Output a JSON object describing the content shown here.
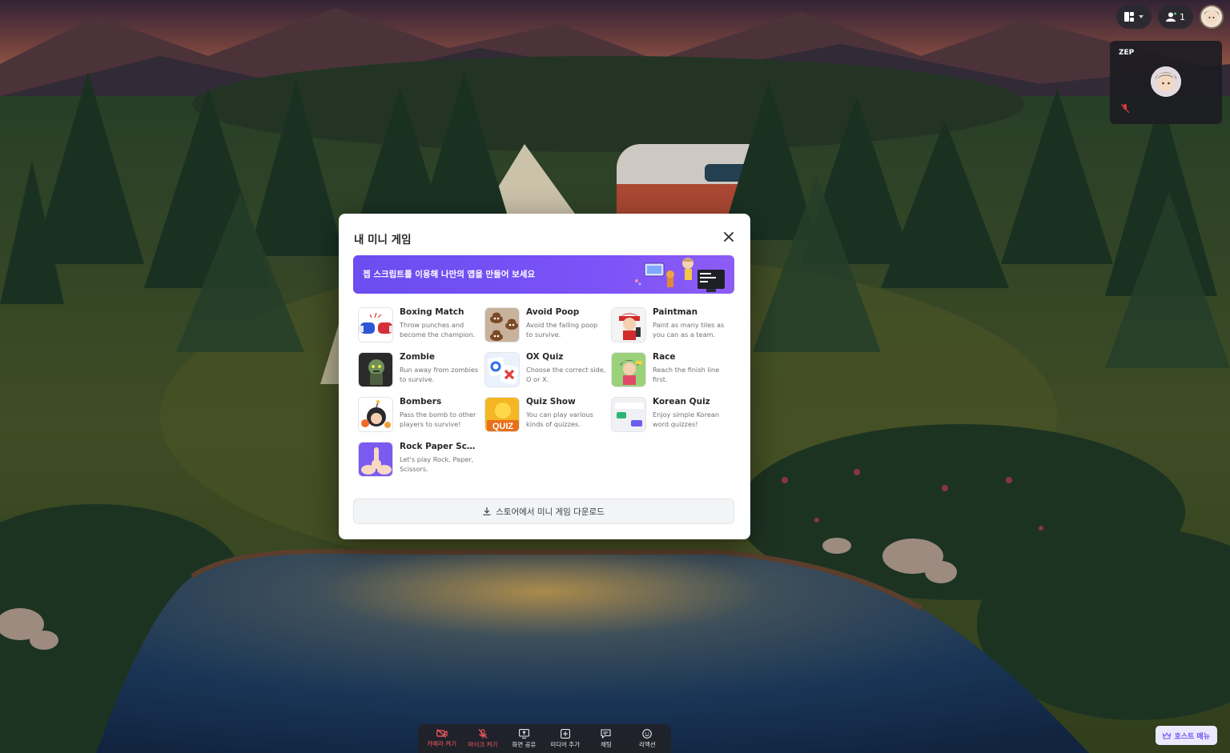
{
  "top_bar": {
    "layout_button_icon": "layout-grid-icon",
    "participants_count": "1",
    "participants_icon": "person-icon"
  },
  "video_tile": {
    "name": "ZEP",
    "mic_icon": "mic-off-icon"
  },
  "modal": {
    "title": "내 미니 게임",
    "close_icon": "close-icon",
    "banner_text": "젭 스크립트를 이용해 나만의 앱을 만들어 보세요",
    "games": [
      {
        "title": "Boxing Match",
        "desc": "Throw punches and become the champion.",
        "icon": "boxing-gloves-icon"
      },
      {
        "title": "Avoid Poop",
        "desc": "Avoid the falling poop to survive.",
        "icon": "poop-icon"
      },
      {
        "title": "Paintman",
        "desc": "Paint as many tiles as you can as a team.",
        "icon": "painter-character-icon"
      },
      {
        "title": "Zombie",
        "desc": "Run away from zombies to survive.",
        "icon": "zombie-icon"
      },
      {
        "title": "OX Quiz",
        "desc": "Choose the correct side, O or X.",
        "icon": "ox-quiz-icon"
      },
      {
        "title": "Race",
        "desc": "Reach the finish line first.",
        "icon": "racer-character-icon"
      },
      {
        "title": "Bombers",
        "desc": "Pass the bomb to other players to survive!",
        "icon": "bomber-character-icon"
      },
      {
        "title": "Quiz Show",
        "desc": "You can play various kinds of quizzes.",
        "icon": "quiz-show-icon"
      },
      {
        "title": "Korean Quiz",
        "desc": "Enjoy simple Korean word quizzes!",
        "icon": "korean-quiz-icon"
      },
      {
        "title": "Rock Paper Sciss...",
        "desc": "Let's play Rock, Paper, Scissors.",
        "icon": "hands-icon"
      }
    ],
    "download_label": "스토어에서 미니 게임 다운로드",
    "download_icon": "download-icon"
  },
  "bottom_bar": {
    "items": [
      {
        "label": "카메라 켜기",
        "icon": "camera-off-icon",
        "state": "off"
      },
      {
        "label": "마이크 켜기",
        "icon": "mic-off-icon",
        "state": "off"
      },
      {
        "label": "화면 공유",
        "icon": "screen-share-icon",
        "state": "on"
      },
      {
        "label": "미디어 추가",
        "icon": "add-media-icon",
        "state": "on"
      },
      {
        "label": "채팅",
        "icon": "chat-icon",
        "state": "on"
      },
      {
        "label": "리액션",
        "icon": "reaction-icon",
        "state": "on"
      }
    ],
    "host_menu_label": "호스트 메뉴",
    "host_menu_icon": "crown-icon"
  },
  "colors": {
    "accent": "#6b4df0",
    "danger": "#ff5b5b",
    "bar_bg": "#222228"
  }
}
